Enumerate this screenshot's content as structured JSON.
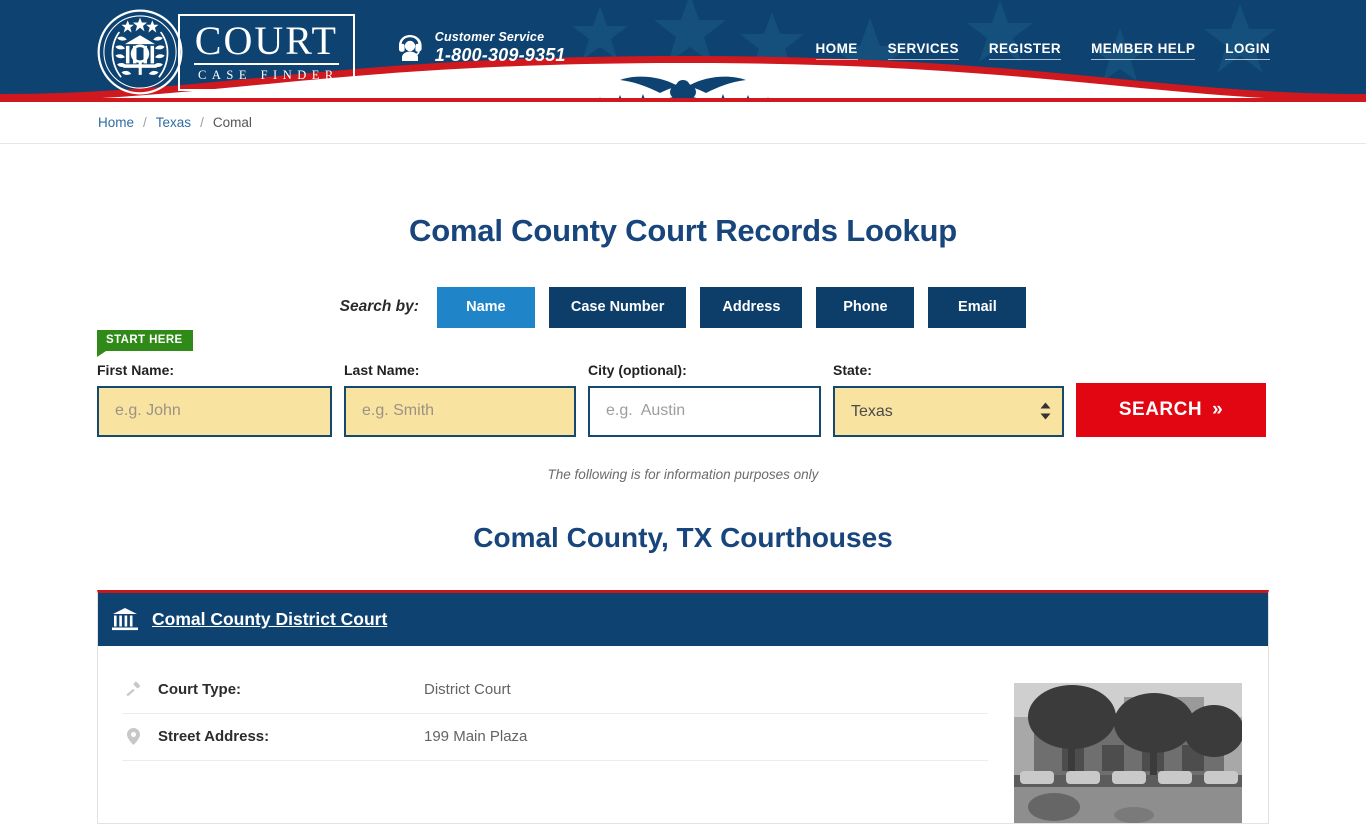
{
  "header": {
    "logo": {
      "title": "COURT",
      "subtitle": "CASE FINDER",
      "seal_alt": "court-seal"
    },
    "customer_service": {
      "label": "Customer Service",
      "phone": "1-800-309-9351"
    },
    "nav": [
      {
        "label": "HOME"
      },
      {
        "label": "SERVICES"
      },
      {
        "label": "REGISTER"
      },
      {
        "label": "MEMBER HELP"
      },
      {
        "label": "LOGIN"
      }
    ]
  },
  "breadcrumb": {
    "home": "Home",
    "state": "Texas",
    "current": "Comal",
    "separator": "/"
  },
  "main": {
    "page_title": "Comal County Court Records Lookup",
    "search_by_label": "Search by:",
    "tabs": [
      {
        "label": "Name",
        "active": true
      },
      {
        "label": "Case Number",
        "active": false
      },
      {
        "label": "Address",
        "active": false
      },
      {
        "label": "Phone",
        "active": false
      },
      {
        "label": "Email",
        "active": false
      }
    ],
    "start_badge": "START HERE",
    "form": {
      "first_name": {
        "label": "First Name:",
        "placeholder": "e.g. John",
        "value": ""
      },
      "last_name": {
        "label": "Last Name:",
        "placeholder": "e.g. Smith",
        "value": ""
      },
      "city": {
        "label": "City (optional):",
        "placeholder": "e.g.  Austin",
        "value": ""
      },
      "state": {
        "label": "State:",
        "selected": "Texas",
        "options": [
          "Texas"
        ]
      },
      "search_button": "SEARCH",
      "search_button_arrow": "»"
    },
    "disclaimer": "The following is for information purposes only",
    "section_title": "Comal County, TX Courthouses"
  },
  "court": {
    "name": "Comal County District Court",
    "details": [
      {
        "icon": "gavel-icon",
        "label": "Court Type:",
        "value": "District Court"
      },
      {
        "icon": "map-pin-icon",
        "label": "Street Address:",
        "value": "199 Main Plaza"
      }
    ],
    "photo_alt": "comal-county-courthouse-photo"
  },
  "colors": {
    "navy": "#0d4271",
    "red": "#d0191e",
    "accent_blue": "#2084c8",
    "tab_navy": "#0d3e69",
    "input_yellow": "#f9e3a0",
    "badge_green": "#2f8a18",
    "search_red": "#e20613",
    "heading_blue": "#17457c"
  }
}
